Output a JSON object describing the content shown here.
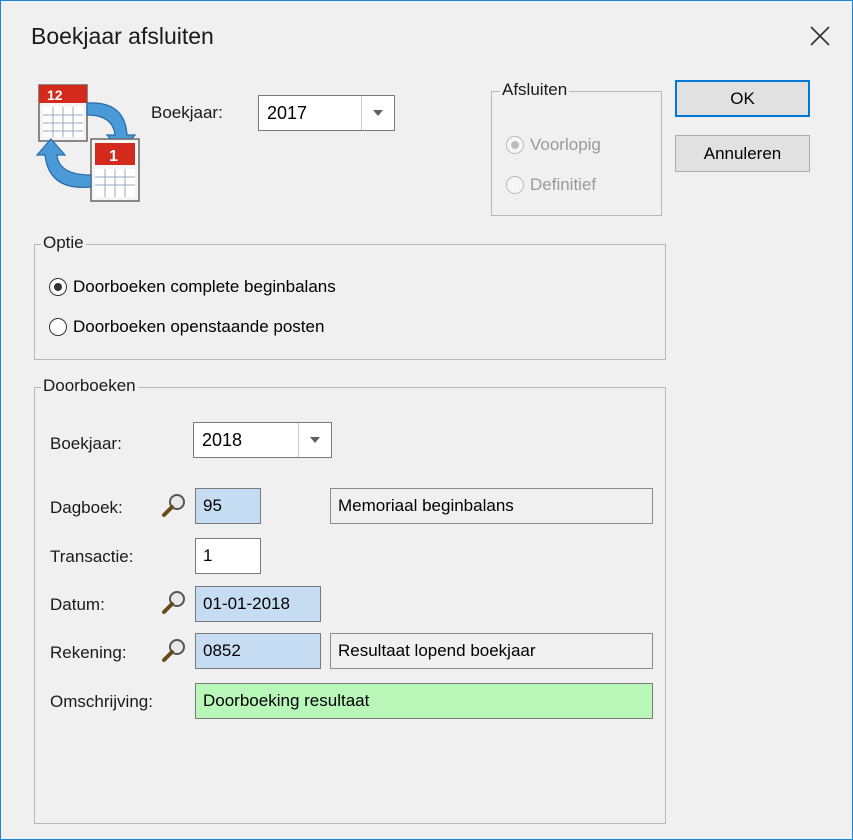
{
  "window": {
    "title": "Boekjaar afsluiten"
  },
  "top": {
    "boekjaar_label": "Boekjaar:",
    "boekjaar_value": "2017",
    "calendar_icon_numbers": [
      "12",
      "1"
    ]
  },
  "afsluiten": {
    "label": "Afsluiten",
    "options": [
      {
        "label": "Voorlopig",
        "checked": true,
        "disabled": true
      },
      {
        "label": "Definitief",
        "checked": false,
        "disabled": true
      }
    ]
  },
  "buttons": {
    "ok": "OK",
    "cancel": "Annuleren"
  },
  "optie": {
    "label": "Optie",
    "options": [
      {
        "label": "Doorboeken complete beginbalans",
        "checked": true
      },
      {
        "label": "Doorboeken openstaande posten",
        "checked": false
      }
    ]
  },
  "doorboeken": {
    "label": "Doorboeken",
    "boekjaar_label": "Boekjaar:",
    "boekjaar_value": "2018",
    "dagboek_label": "Dagboek:",
    "dagboek_value": "95",
    "dagboek_desc": "Memoriaal beginbalans",
    "transactie_label": "Transactie:",
    "transactie_value": "1",
    "datum_label": "Datum:",
    "datum_value": "01-01-2018",
    "rekening_label": "Rekening:",
    "rekening_value": "0852",
    "rekening_desc": "Resultaat lopend boekjaar",
    "omschrijving_label": "Omschrijving:",
    "omschrijving_value": "Doorboeking resultaat"
  },
  "colors": {
    "accent": "#0078d7",
    "lookup_field": "#c5dcf3",
    "description_field": "#b9f7b9"
  }
}
